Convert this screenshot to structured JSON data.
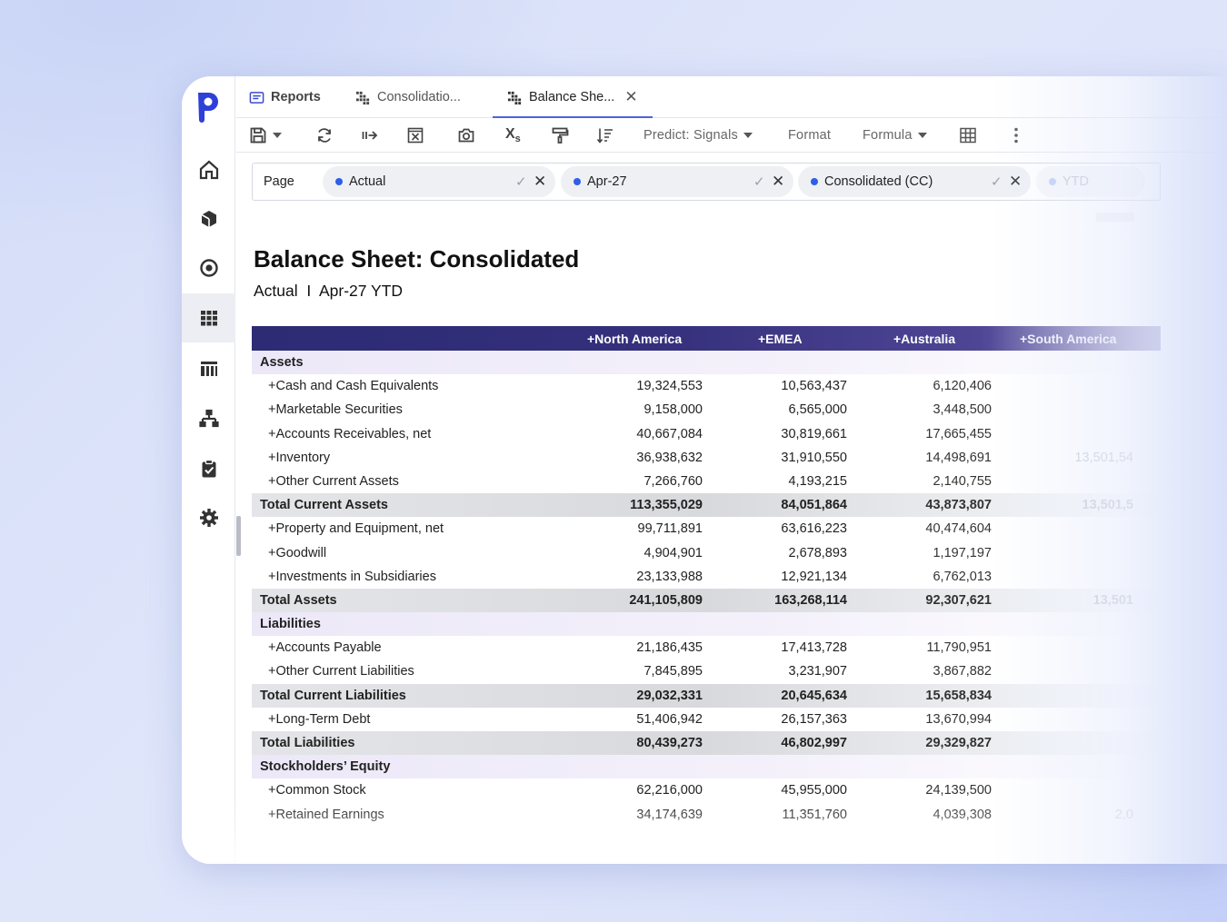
{
  "tabs": [
    {
      "label": "Reports",
      "icon": "report-icon"
    },
    {
      "label": "Consolidatio...",
      "icon": "cube-grid-icon"
    },
    {
      "label": "Balance She...",
      "icon": "cube-grid-icon",
      "active": true
    }
  ],
  "toolbar": {
    "predict_label": "Predict: Signals",
    "format_label": "Format",
    "formula_label": "Formula"
  },
  "filters": {
    "page_label": "Page",
    "chips": [
      "Actual",
      "Apr-27",
      "Consolidated (CC)",
      "YTD"
    ]
  },
  "report": {
    "title": "Balance Sheet: Consolidated",
    "subtitle": "Actual  I  Apr-27 YTD"
  },
  "table": {
    "columns": [
      "+North America",
      "+EMEA",
      "+Australia",
      "+South America"
    ],
    "rows": [
      {
        "type": "section",
        "label": "Assets",
        "values": [
          "",
          "",
          "",
          ""
        ]
      },
      {
        "type": "item",
        "label": "+Cash and Cash Equivalents",
        "values": [
          "19,324,553",
          "10,563,437",
          "6,120,406",
          ""
        ]
      },
      {
        "type": "item",
        "label": "+Marketable Securities",
        "values": [
          "9,158,000",
          "6,565,000",
          "3,448,500",
          ""
        ]
      },
      {
        "type": "item",
        "label": "+Accounts Receivables, net",
        "values": [
          "40,667,084",
          "30,819,661",
          "17,665,455",
          ""
        ]
      },
      {
        "type": "item",
        "label": "+Inventory",
        "values": [
          "36,938,632",
          "31,910,550",
          "14,498,691",
          "13,501,54"
        ]
      },
      {
        "type": "item",
        "label": "+Other Current Assets",
        "values": [
          "7,266,760",
          "4,193,215",
          "2,140,755",
          ""
        ]
      },
      {
        "type": "total",
        "label": "Total Current Assets",
        "values": [
          "113,355,029",
          "84,051,864",
          "43,873,807",
          "13,501,5"
        ]
      },
      {
        "type": "item",
        "label": "+Property and Equipment, net",
        "values": [
          "99,711,891",
          "63,616,223",
          "40,474,604",
          ""
        ]
      },
      {
        "type": "item",
        "label": "+Goodwill",
        "values": [
          "4,904,901",
          "2,678,893",
          "1,197,197",
          ""
        ]
      },
      {
        "type": "item",
        "label": "+Investments in Subsidiaries",
        "values": [
          "23,133,988",
          "12,921,134",
          "6,762,013",
          ""
        ]
      },
      {
        "type": "total",
        "label": "Total Assets",
        "values": [
          "241,105,809",
          "163,268,114",
          "92,307,621",
          "13,501"
        ]
      },
      {
        "type": "section",
        "label": "Liabilities",
        "values": [
          "",
          "",
          "",
          ""
        ]
      },
      {
        "type": "item",
        "label": "+Accounts Payable",
        "values": [
          "21,186,435",
          "17,413,728",
          "11,790,951",
          ""
        ]
      },
      {
        "type": "item",
        "label": "+Other Current Liabilities",
        "values": [
          "7,845,895",
          "3,231,907",
          "3,867,882",
          ""
        ]
      },
      {
        "type": "total",
        "label": "Total Current Liabilities",
        "values": [
          "29,032,331",
          "20,645,634",
          "15,658,834",
          ""
        ]
      },
      {
        "type": "item",
        "label": "+Long-Term Debt",
        "values": [
          "51,406,942",
          "26,157,363",
          "13,670,994",
          ""
        ]
      },
      {
        "type": "total",
        "label": "Total Liabilities",
        "values": [
          "80,439,273",
          "46,802,997",
          "29,329,827",
          ""
        ]
      },
      {
        "type": "section",
        "label": "Stockholders’ Equity",
        "values": [
          "",
          "",
          "",
          ""
        ]
      },
      {
        "type": "item",
        "label": "+Common Stock",
        "values": [
          "62,216,000",
          "45,955,000",
          "24,139,500",
          ""
        ]
      },
      {
        "type": "item",
        "label": "+Retained Earnings",
        "values": [
          "34,174,639",
          "11,351,760",
          "4,039,308",
          "2,0"
        ]
      }
    ]
  },
  "colors": {
    "accent": "#4b64e0",
    "header_dark": "#2c2b74",
    "chip_dot": "#2f5ee8"
  }
}
